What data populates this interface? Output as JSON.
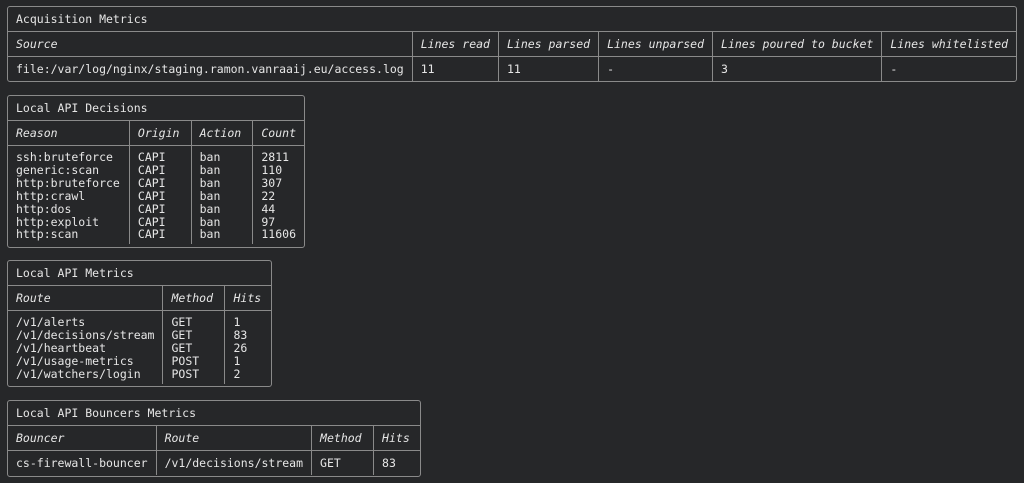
{
  "acquisition": {
    "title": "Acquisition Metrics",
    "headers": [
      "Source",
      "Lines read",
      "Lines parsed",
      "Lines unparsed",
      "Lines poured to bucket",
      "Lines whitelisted"
    ],
    "row": [
      "file:/var/log/nginx/staging.ramon.vanraaij.eu/access.log",
      "11",
      "11",
      "-",
      "3",
      "-"
    ]
  },
  "decisions": {
    "title": "Local API Decisions",
    "headers": [
      "Reason",
      "Origin",
      "Action",
      "Count"
    ],
    "rows": [
      [
        "ssh:bruteforce",
        "CAPI",
        "ban",
        "2811"
      ],
      [
        "generic:scan",
        "CAPI",
        "ban",
        "110"
      ],
      [
        "http:bruteforce",
        "CAPI",
        "ban",
        "307"
      ],
      [
        "http:crawl",
        "CAPI",
        "ban",
        "22"
      ],
      [
        "http:dos",
        "CAPI",
        "ban",
        "44"
      ],
      [
        "http:exploit",
        "CAPI",
        "ban",
        "97"
      ],
      [
        "http:scan",
        "CAPI",
        "ban",
        "11606"
      ]
    ]
  },
  "api_metrics": {
    "title": "Local API Metrics",
    "headers": [
      "Route",
      "Method",
      "Hits"
    ],
    "rows": [
      [
        "/v1/alerts",
        "GET",
        "1"
      ],
      [
        "/v1/decisions/stream",
        "GET",
        "83"
      ],
      [
        "/v1/heartbeat",
        "GET",
        "26"
      ],
      [
        "/v1/usage-metrics",
        "POST",
        "1"
      ],
      [
        "/v1/watchers/login",
        "POST",
        "2"
      ]
    ]
  },
  "bouncers": {
    "title": "Local API Bouncers Metrics",
    "headers": [
      "Bouncer",
      "Route",
      "Method",
      "Hits"
    ],
    "row": [
      "cs-firewall-bouncer",
      "/v1/decisions/stream",
      "GET",
      "83"
    ]
  }
}
